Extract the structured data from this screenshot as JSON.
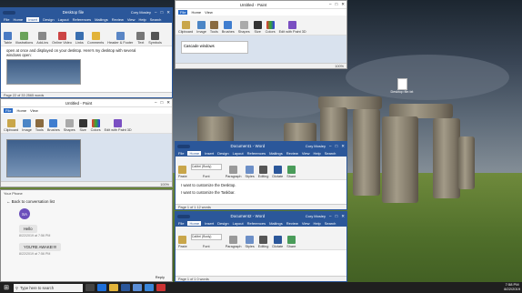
{
  "desktop": {
    "icon_label": "Desktop file.txt"
  },
  "word_top_left": {
    "title": "Desktop file",
    "title_right": "Cory Mosley",
    "tabs": [
      "File",
      "Home",
      "Insert",
      "Design",
      "Layout",
      "References",
      "Mailings",
      "Review",
      "View",
      "Help",
      "Search"
    ],
    "ribbon": [
      "Table",
      "Illustrations",
      "Add-ins",
      "Online Video",
      "Links",
      "Comments",
      "Header & Footer",
      "Text",
      "Symbols"
    ],
    "body_line1": "open at once and displayed on your desktop. Here's my desktop with several",
    "body_line2": "windows open:",
    "status": "Page 22 of 33   2565 words"
  },
  "paint_top": {
    "title": "Untitled - Paint",
    "tabs": [
      "File",
      "Home",
      "View"
    ],
    "ribbon": [
      "Clipboard",
      "Image",
      "Tools",
      "Brushes",
      "Shapes",
      "Size",
      "Colors",
      "Edit with Paint 3D"
    ],
    "selection": "Cascade windows",
    "zoom": "100%"
  },
  "paint_mid": {
    "title": "Untitled - Paint",
    "tabs": [
      "File",
      "Home",
      "View"
    ],
    "ribbon": [
      "Clipboard",
      "Image",
      "Tools",
      "Brushes",
      "Shapes",
      "Size",
      "Colors",
      "Edit with Paint 3D"
    ],
    "zoom": "100%"
  },
  "phone": {
    "app": "Your Phone",
    "back": "Back to conversation list",
    "avatar": "SA",
    "msg1": "Hello",
    "ts1": "8/22/2019 at 7:56 PM",
    "msg2": "YOU'RE AWAKE!!!!",
    "ts2": "8/22/2019 at 7:56 PM",
    "reply": "Reply"
  },
  "word_mid": {
    "title": "Document1 - Word",
    "user": "Cory Mosley",
    "tabs": [
      "File",
      "Home",
      "Insert",
      "Design",
      "Layout",
      "References",
      "Mailings",
      "Review",
      "View",
      "Help",
      "Search"
    ],
    "ribbon": [
      "Paste",
      "Calibri (Body)",
      "Paragraph",
      "Styles",
      "Editing",
      "Dictate",
      "Share"
    ],
    "groups": [
      "Clipboard",
      "Font",
      "Paragraph",
      "Styles",
      "Voice",
      "Community"
    ],
    "line1": "I want to customize the Desktop.",
    "line2": "I want to customize the Taskbar.",
    "status": "Page 1 of 1   12 words"
  },
  "word_bottom": {
    "title": "Document2 - Word",
    "user": "Cory Mosley",
    "tabs": [
      "File",
      "Home",
      "Insert",
      "Design",
      "Layout",
      "References",
      "Mailings",
      "Review",
      "View",
      "Help",
      "Search"
    ],
    "ribbon": [
      "Paste",
      "Calibri (Body)",
      "Paragraph",
      "Styles",
      "Editing",
      "Dictate",
      "Share"
    ],
    "groups": [
      "Clipboard",
      "Font",
      "Paragraph",
      "Styles",
      "Voice",
      "Community"
    ],
    "status": "Page 1 of 1   0 words"
  },
  "taskbar": {
    "search": "Type here to search",
    "time": "7:58 PM",
    "date": "8/22/2019"
  },
  "colors": {
    "word": "#2b579a",
    "paint_title": "#ffffff",
    "taskbar": "#1f1f1f"
  }
}
